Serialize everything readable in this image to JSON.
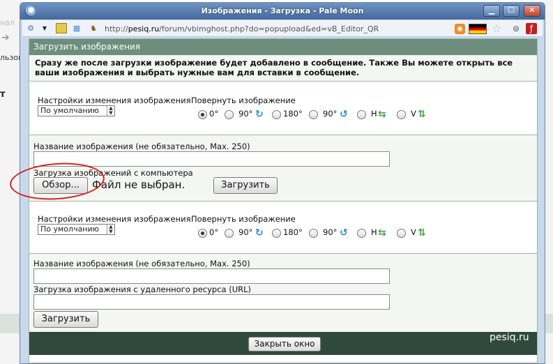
{
  "window": {
    "title": "Изображения - Загрузка - Pale Moon",
    "url_prefix": "http://",
    "url_host": "pesiq.ru",
    "url_path": "/forum/vbimghost.php?do=popupload&ed=vB_Editor_QR"
  },
  "background": {
    "left_text_1": "нал",
    "left_text_2": "льзова",
    "left_text_3": "т"
  },
  "dialog": {
    "header": "Загрузить изображения",
    "intro": "Сразу же после загрузки изображение будет добавлено в сообщение. Также Вы можете открыть все ваши изображения и выбрать нужные вам для вставки в сообщение.",
    "resize_label": "Настройки изменения изображения",
    "resize_value": "По умолчанию",
    "rotate_label": "Повернуть изображение",
    "rotate_options": [
      "0°",
      "90°",
      "180°",
      "90°",
      "H",
      "V"
    ],
    "name_label": "Название изображения (не обязательно, Max. 250)",
    "upload_pc_label": "Загрузка изображений с компьютера",
    "browse_button": "Обзор...",
    "no_file_text": "Файл не выбран.",
    "upload_button": "Загрузить",
    "url_label": "Загрузка изображения с удаленного ресурса (URL)",
    "close_button": "Закрыть окно",
    "watermark": "pesiq.ru"
  },
  "colors": {
    "header_bg": "#6d8e7c",
    "footer_bg": "#2f4a3c",
    "annotation": "#d52020"
  }
}
